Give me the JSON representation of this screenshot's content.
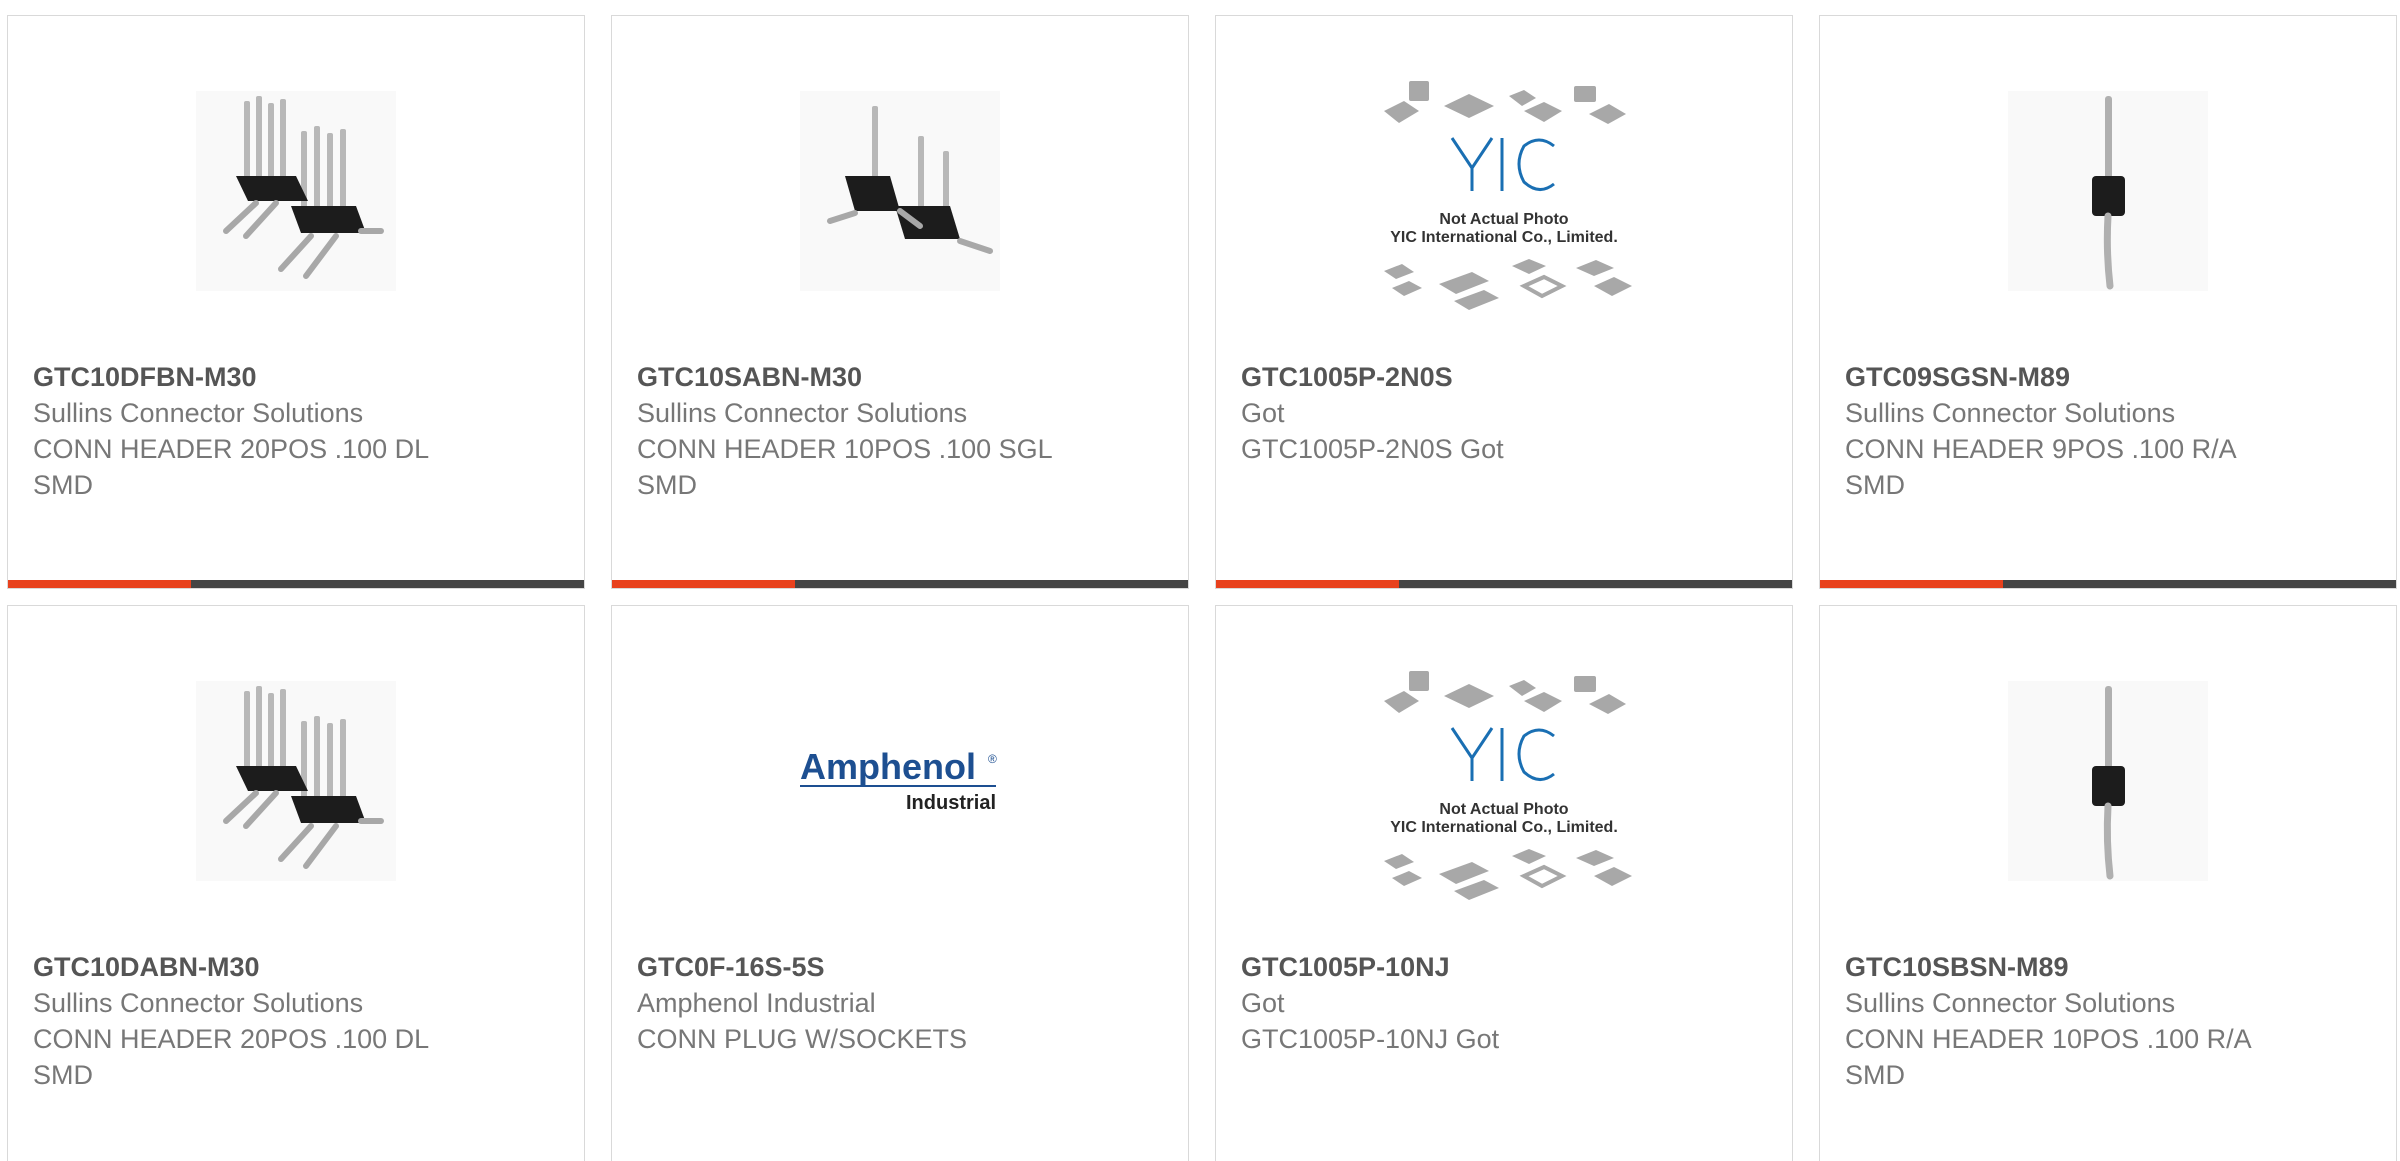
{
  "accent_color": "#e8411d",
  "bar_color": "#444444",
  "products": [
    {
      "part_number": "GTC10DFBN-M30",
      "manufacturer": "Sullins Connector Solutions",
      "description": "CONN HEADER 20POS .100 DL SMD",
      "image": "dual-row-header-icon"
    },
    {
      "part_number": "GTC10SABN-M30",
      "manufacturer": "Sullins Connector Solutions",
      "description": "CONN HEADER 10POS .100 SGL SMD",
      "image": "single-row-header-icon"
    },
    {
      "part_number": "GTC1005P-2N0S",
      "manufacturer": "Got",
      "description": "GTC1005P-2N0S Got",
      "image": "yic-placeholder-icon"
    },
    {
      "part_number": "GTC09SGSN-M89",
      "manufacturer": "Sullins Connector Solutions",
      "description": "CONN HEADER 9POS .100 R/A SMD",
      "image": "single-pin-header-icon"
    },
    {
      "part_number": "GTC10DABN-M30",
      "manufacturer": "Sullins Connector Solutions",
      "description": "CONN HEADER 20POS .100 DL SMD",
      "image": "dual-row-header-icon"
    },
    {
      "part_number": "GTC0F-16S-5S",
      "manufacturer": "Amphenol Industrial",
      "description": "CONN PLUG W/SOCKETS",
      "image": "amphenol-logo"
    },
    {
      "part_number": "GTC1005P-10NJ",
      "manufacturer": "Got",
      "description": "GTC1005P-10NJ Got",
      "image": "yic-placeholder-icon"
    },
    {
      "part_number": "GTC10SBSN-M89",
      "manufacturer": "Sullins Connector Solutions",
      "description": "CONN HEADER 10POS .100 R/A SMD",
      "image": "single-pin-header-icon"
    }
  ],
  "placeholder_text": {
    "brand": "YIC",
    "line1": "Not Actual Photo",
    "line2": "YIC International Co., Limited."
  },
  "amphenol_logo": {
    "name": "Amphenol",
    "registered": "®",
    "sub": "Industrial"
  }
}
